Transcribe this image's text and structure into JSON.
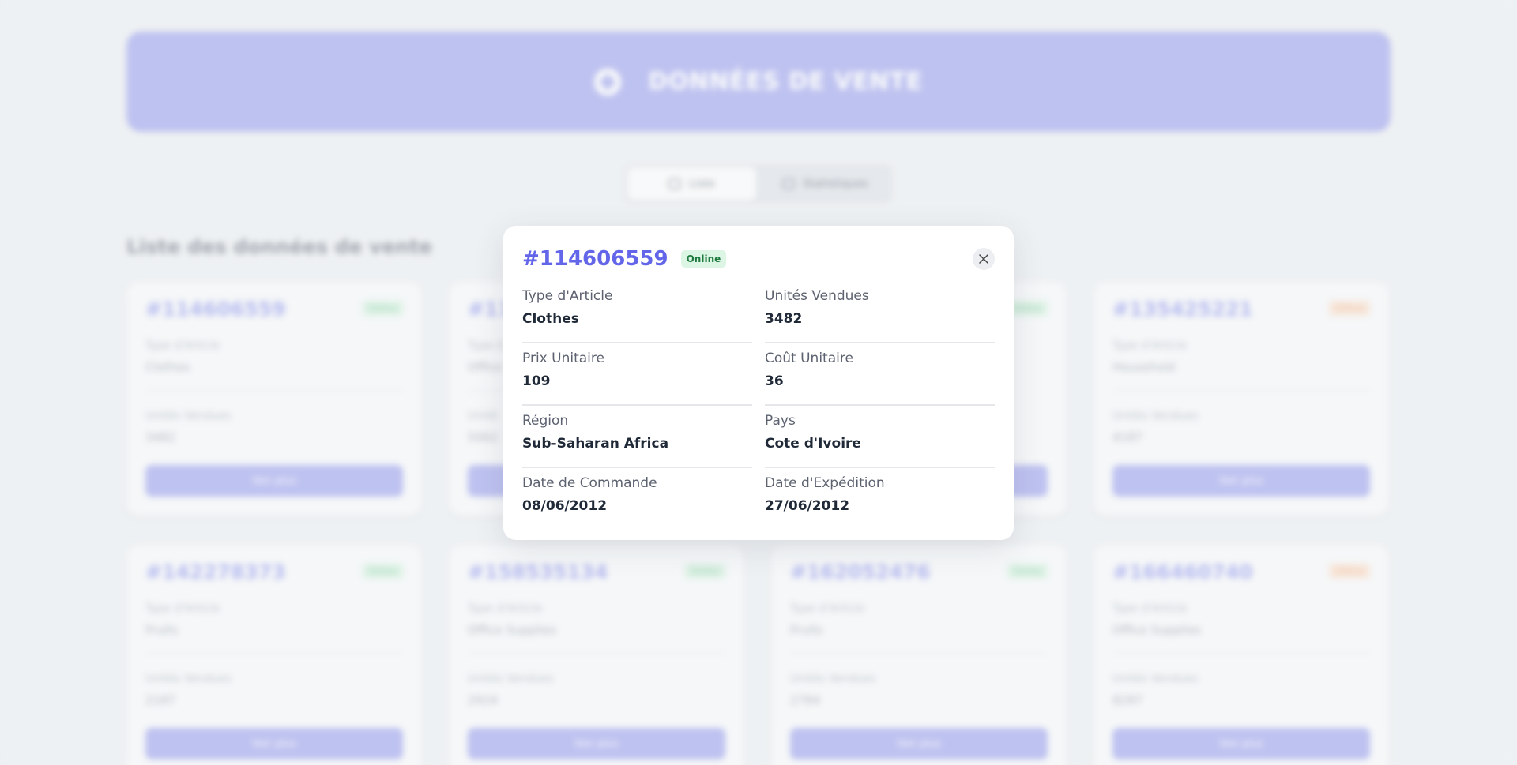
{
  "header": {
    "title": "DONNÉES DE VENTE",
    "logo_icon": "cube-icon"
  },
  "tabs": [
    {
      "label": "Liste",
      "icon": "calendar-icon",
      "active": true
    },
    {
      "label": "Statistiques",
      "icon": "chart-icon",
      "active": false
    }
  ],
  "section_title": "Liste des données de vente",
  "cards": [
    {
      "id": "#114606559",
      "status": "Online",
      "type_label": "Type d'Article",
      "type": "Clothes",
      "units_label": "Unités Vendues",
      "units": "3482",
      "button": "Voir plus"
    },
    {
      "id": "#11",
      "status": "",
      "type_label": "Type d",
      "type": "Office",
      "units_label": "Unité",
      "units": "5062",
      "button": ""
    },
    {
      "id": "",
      "status": "Online",
      "type_label": "",
      "type": "",
      "units_label": "",
      "units": "",
      "button": ""
    },
    {
      "id": "#135425221",
      "status": "Offline",
      "type_label": "Type d'Article",
      "type": "Household",
      "units_label": "Unités Vendues",
      "units": "4187",
      "button": "Voir plus"
    },
    {
      "id": "#142278373",
      "status": "Online",
      "type_label": "Type d'Article",
      "type": "Fruits",
      "units_label": "Unités Vendues",
      "units": "2187",
      "button": "Voir plus"
    },
    {
      "id": "#158535134",
      "status": "Online",
      "type_label": "Type d'Article",
      "type": "Office Supplies",
      "units_label": "Unités Vendues",
      "units": "2924",
      "button": "Voir plus"
    },
    {
      "id": "#162052476",
      "status": "Online",
      "type_label": "Type d'Article",
      "type": "Fruits",
      "units_label": "Unités Vendues",
      "units": "2784",
      "button": "Voir plus"
    },
    {
      "id": "#166460740",
      "status": "Offline",
      "type_label": "Type d'Article",
      "type": "Office Supplies",
      "units_label": "Unités Vendues",
      "units": "8287",
      "button": "Voir plus"
    }
  ],
  "modal": {
    "id": "#114606559",
    "status": "Online",
    "close_icon": "close-icon",
    "fields": [
      {
        "label": "Type d'Article",
        "value": "Clothes"
      },
      {
        "label": "Unités Vendues",
        "value": "3482"
      },
      {
        "label": "Prix Unitaire",
        "value": "109"
      },
      {
        "label": "Coût Unitaire",
        "value": "36"
      },
      {
        "label": "Région",
        "value": "Sub-Saharan Africa"
      },
      {
        "label": "Pays",
        "value": "Cote d'Ivoire"
      },
      {
        "label": "Date de Commande",
        "value": "08/06/2012"
      },
      {
        "label": "Date d'Expédition",
        "value": "27/06/2012"
      }
    ]
  },
  "colors": {
    "accent": "#6366e8",
    "header_bg": "#aeb2ef",
    "online_bg": "#dcf5e4",
    "offline_bg": "#fbe4d5"
  }
}
